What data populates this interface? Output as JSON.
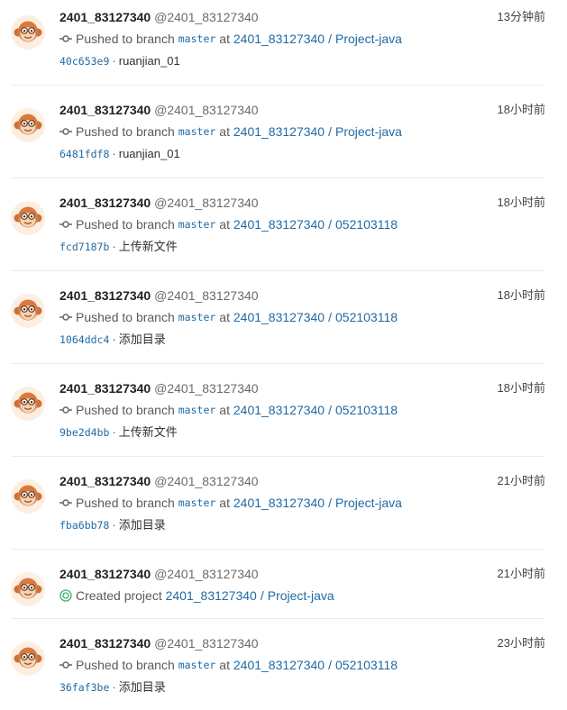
{
  "events": [
    {
      "type": "push",
      "username": "2401_83127340",
      "handle": "@2401_83127340",
      "time": "13分钟前",
      "pushed_text": "Pushed to branch",
      "branch": "master",
      "at_text": "at",
      "project_owner": "2401_83127340",
      "project_sep": "/",
      "project_name": "Project-java",
      "sha": "40c653e9",
      "commit_sep": "·",
      "message": "ruanjian_01"
    },
    {
      "type": "push",
      "username": "2401_83127340",
      "handle": "@2401_83127340",
      "time": "18小时前",
      "pushed_text": "Pushed to branch",
      "branch": "master",
      "at_text": "at",
      "project_owner": "2401_83127340",
      "project_sep": "/",
      "project_name": "Project-java",
      "sha": "6481fdf8",
      "commit_sep": "·",
      "message": "ruanjian_01"
    },
    {
      "type": "push",
      "username": "2401_83127340",
      "handle": "@2401_83127340",
      "time": "18小时前",
      "pushed_text": "Pushed to branch",
      "branch": "master",
      "at_text": "at",
      "project_owner": "2401_83127340",
      "project_sep": "/",
      "project_name": "052103118",
      "sha": "fcd7187b",
      "commit_sep": "·",
      "message": "上传新文件"
    },
    {
      "type": "push",
      "username": "2401_83127340",
      "handle": "@2401_83127340",
      "time": "18小时前",
      "pushed_text": "Pushed to branch",
      "branch": "master",
      "at_text": "at",
      "project_owner": "2401_83127340",
      "project_sep": "/",
      "project_name": "052103118",
      "sha": "1064ddc4",
      "commit_sep": "·",
      "message": "添加目录"
    },
    {
      "type": "push",
      "username": "2401_83127340",
      "handle": "@2401_83127340",
      "time": "18小时前",
      "pushed_text": "Pushed to branch",
      "branch": "master",
      "at_text": "at",
      "project_owner": "2401_83127340",
      "project_sep": "/",
      "project_name": "052103118",
      "sha": "9be2d4bb",
      "commit_sep": "·",
      "message": "上传新文件"
    },
    {
      "type": "push",
      "username": "2401_83127340",
      "handle": "@2401_83127340",
      "time": "21小时前",
      "pushed_text": "Pushed to branch",
      "branch": "master",
      "at_text": "at",
      "project_owner": "2401_83127340",
      "project_sep": "/",
      "project_name": "Project-java",
      "sha": "fba6bb78",
      "commit_sep": "·",
      "message": "添加目录"
    },
    {
      "type": "create",
      "username": "2401_83127340",
      "handle": "@2401_83127340",
      "time": "21小时前",
      "created_text": "Created project",
      "project_owner": "2401_83127340",
      "project_sep": "/",
      "project_name": "Project-java"
    },
    {
      "type": "push",
      "username": "2401_83127340",
      "handle": "@2401_83127340",
      "time": "23小时前",
      "pushed_text": "Pushed to branch",
      "branch": "master",
      "at_text": "at",
      "project_owner": "2401_83127340",
      "project_sep": "/",
      "project_name": "052103118",
      "sha": "36faf3be",
      "commit_sep": "·",
      "message": "添加目录"
    }
  ],
  "icons": {
    "avatar": "monkey-avatar-icon",
    "push": "commit-icon",
    "create": "created-project-icon"
  },
  "colors": {
    "link": "#1f6aa5",
    "create_icon": "#3cb371"
  }
}
